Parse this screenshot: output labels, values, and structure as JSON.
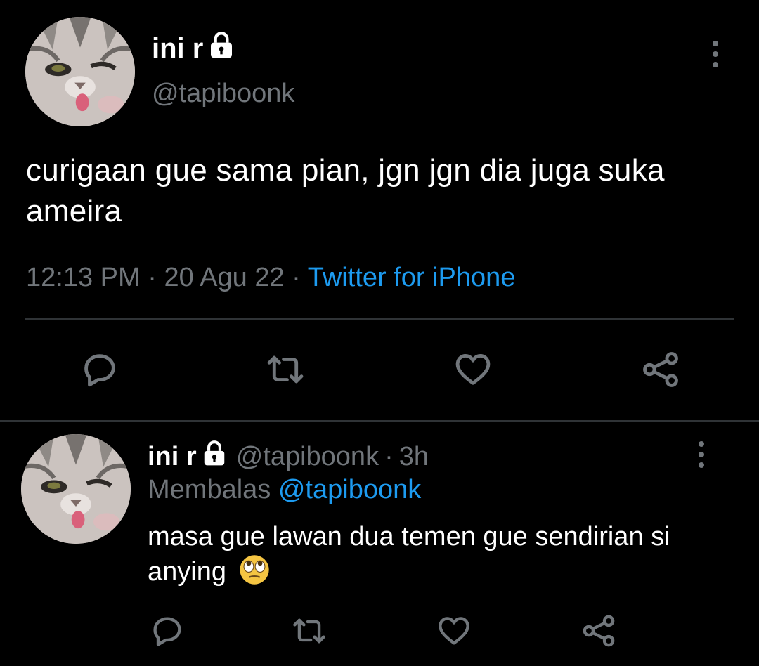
{
  "main_tweet": {
    "display_name": "ini r",
    "handle": "@tapiboonk",
    "text": "curigaan gue sama pian, jgn jgn dia juga suka ameira",
    "time": "12:13 PM",
    "date": "20 Agu 22",
    "separator": "·",
    "source": "Twitter for iPhone",
    "icons": [
      "lock-icon",
      "more-icon",
      "reply-icon",
      "retweet-icon",
      "like-icon",
      "share-icon"
    ]
  },
  "reply_tweet": {
    "display_name": "ini r",
    "handle": "@tapiboonk",
    "age": "3h",
    "separator": "·",
    "replying_label": "Membalas",
    "replying_to": "@tapiboonk",
    "text": "masa gue lawan dua temen gue sendirian si anying",
    "emoji": "face-with-rolling-eyes"
  },
  "colors": {
    "background": "#000000",
    "text": "#e7e9ea",
    "secondary": "#71767b",
    "accent": "#1d9bf0",
    "divider": "#2f3336"
  }
}
